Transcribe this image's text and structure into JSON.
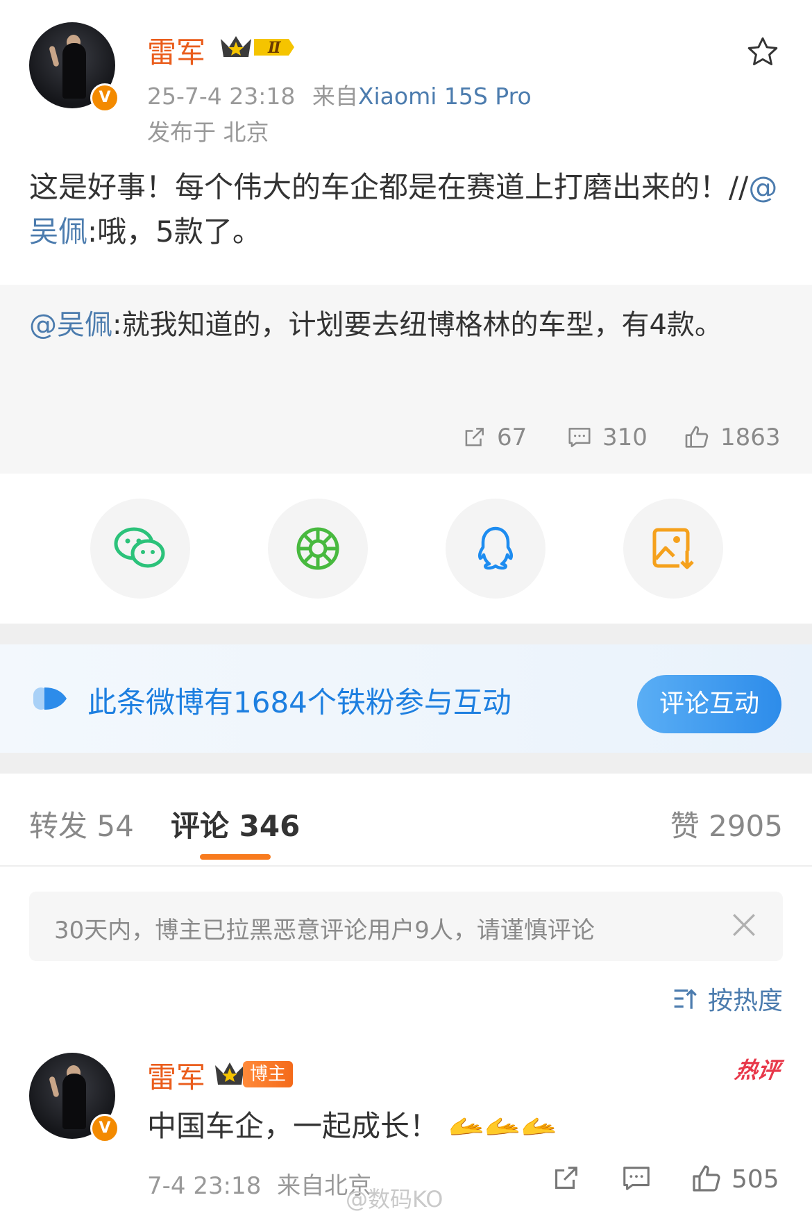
{
  "post": {
    "author": "雷军",
    "time": "25-7-4 23:18",
    "source_prefix": "来自",
    "device": "Xiaomi 15S Pro",
    "location": "发布于 北京",
    "text_before": "这是好事！每个伟大的车企都是在赛道上打磨出来的！//",
    "mention": "@吴佩",
    "text_after": ":哦，5款了。",
    "vip_level": "Ⅱ"
  },
  "quote": {
    "mention": "@吴佩",
    "text": ":就我知道的，计划要去纽博格林的车型，有4款。",
    "stats": {
      "reposts": "67",
      "comments": "310",
      "likes": "1863"
    }
  },
  "share": {
    "items": [
      "wechat-icon",
      "moments-icon",
      "qq-icon",
      "save-image-icon"
    ]
  },
  "fans_banner": {
    "text": "此条微博有1684个铁粉参与互动",
    "button": "评论互动"
  },
  "tabs": {
    "repost": "转发 54",
    "comment": "评论 346",
    "like": "赞 2905"
  },
  "notice": "30天内，博主已拉黑恶意评论用户9人，请谨慎评论",
  "sort_label": "按热度",
  "comment": {
    "author": "雷军",
    "tag": "博主",
    "hot_label": "热评",
    "text": "中国车企，一起成长！",
    "emoji": "🫴🫴🫴",
    "time": "7-4 23:18",
    "location": "来自北京",
    "likes": "505"
  },
  "watermark": "@数码KO",
  "colors": {
    "accent": "#ea5d1c",
    "link": "#4c7cae",
    "fans_blue": "#1d7fe0"
  }
}
